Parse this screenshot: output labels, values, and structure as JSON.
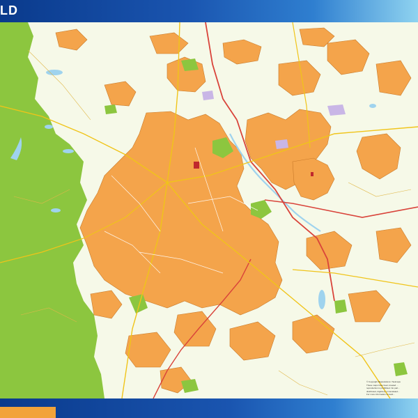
{
  "map": {
    "title": "LD",
    "copyright_lines": [
      "© Copyright Mapsolutions / Netmaps",
      "These maps have been created ...",
      "reproduction is prohibited. No part...",
      "distributed, digitized, or translated...",
      "For more information consult..."
    ],
    "colors": {
      "header": "#1a55b0",
      "header_light": "#8fd3f0",
      "urban": "#f4a44b",
      "urban_outline": "#c97a2a",
      "park_forest": "#8cc63f",
      "background": "#f6f9e8",
      "water": "#9fd3ee",
      "motorway": "#d9433a",
      "main_road": "#f0c419",
      "footer_tab": "#f2a33a",
      "industrial": "#c9b6e6"
    }
  }
}
